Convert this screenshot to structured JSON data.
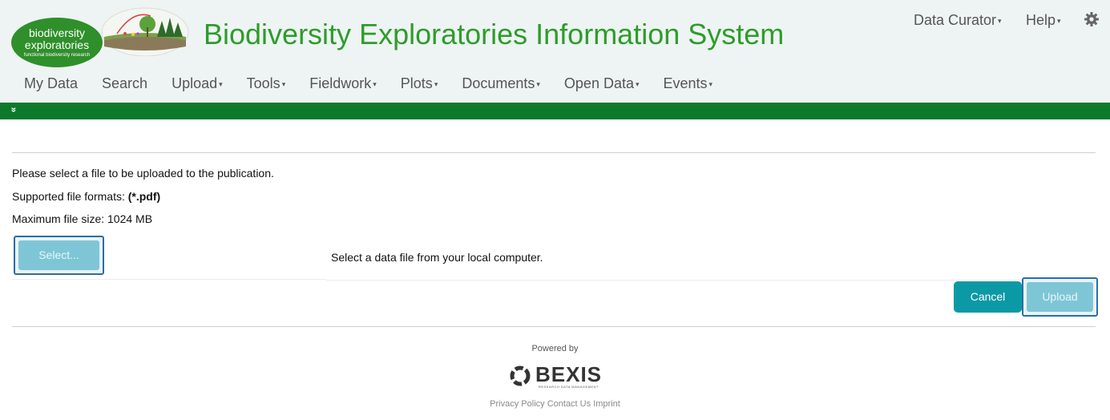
{
  "header": {
    "logo": {
      "line1": "biodiversity",
      "line2": "exploratories",
      "line3": "functional biodiversity research"
    },
    "title": "Biodiversity Exploratories Information System",
    "user_menu": "Data Curator",
    "help_menu": "Help",
    "settings_icon": "gear-icon"
  },
  "nav": {
    "items": [
      {
        "label": "My Data",
        "dropdown": false
      },
      {
        "label": "Search",
        "dropdown": false
      },
      {
        "label": "Upload",
        "dropdown": true
      },
      {
        "label": "Tools",
        "dropdown": true
      },
      {
        "label": "Fieldwork",
        "dropdown": true
      },
      {
        "label": "Plots",
        "dropdown": true
      },
      {
        "label": "Documents",
        "dropdown": true
      },
      {
        "label": "Open Data",
        "dropdown": true
      },
      {
        "label": "Events",
        "dropdown": true
      }
    ],
    "caret": "▾"
  },
  "menu_bar": {
    "collapse_icon": "double-chevron-down-icon",
    "collapse_glyph": "»"
  },
  "main": {
    "instruction": "Please select a file to be uploaded to the publication.",
    "formats_label": "Supported file formats: ",
    "formats_value": "(*.pdf)",
    "max_size": "Maximum file size: 1024 MB",
    "select_button": "Select...",
    "select_description": "Select a data file from your local computer.",
    "cancel_button": "Cancel",
    "upload_button": "Upload"
  },
  "footer": {
    "powered_by": "Powered by",
    "brand": "BEXIS",
    "brand_sub": "RESEARCH DATA MANAGEMENT",
    "links": [
      "Privacy Policy",
      "Contact Us",
      "Imprint"
    ]
  },
  "colors": {
    "header_bg": "#eef4f4",
    "title_green": "#2e9c2a",
    "menu_bar_green": "#0d7a2b",
    "teal_button": "#0b9aa5",
    "disabled_button": "#7ec6d6"
  }
}
